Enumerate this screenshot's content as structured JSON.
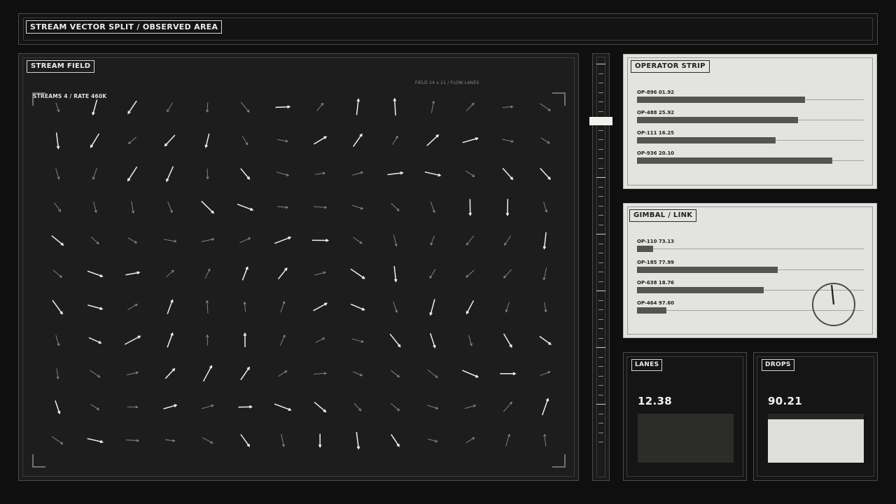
{
  "header": {
    "title": "STREAM VECTOR SPLIT / OBSERVED AREA"
  },
  "field": {
    "title": "STREAM FIELD",
    "meta_left": "STREAMS 4 / RATE 460K",
    "meta_right": "FIELD 14 x 11 / FLOW LANES"
  },
  "slider": {
    "value": 0.15
  },
  "operator_strip": {
    "title": "OPERATOR STRIP",
    "rows": [
      {
        "label": "OP-896  01.92",
        "fill": 0.74
      },
      {
        "label": "OP-488  25.92",
        "fill": 0.71
      },
      {
        "label": "OP-111  16.25",
        "fill": 0.61
      },
      {
        "label": "OP-936  20.10",
        "fill": 0.86
      }
    ]
  },
  "gimbal": {
    "title": "GIMBAL / LINK",
    "rows": [
      {
        "label": "OP-110  73.13",
        "fill": 0.07
      },
      {
        "label": "OP-185  77.99",
        "fill": 0.62
      },
      {
        "label": "OP-638  18.76",
        "fill": 0.56
      },
      {
        "label": "OP-464  97.60",
        "fill": 0.13
      }
    ],
    "dial_angle_deg": -6
  },
  "lanes": {
    "title": "LANES",
    "value": "12.38"
  },
  "drops": {
    "title": "DROPS",
    "value": "90.21",
    "level": 0.88
  },
  "colors": {
    "background": "#0e0f0e",
    "panel_dark": "#1c1d1c",
    "panel_light": "#e3e4e0",
    "bar_fill": "#545553",
    "accent": "#f2f2ef"
  }
}
